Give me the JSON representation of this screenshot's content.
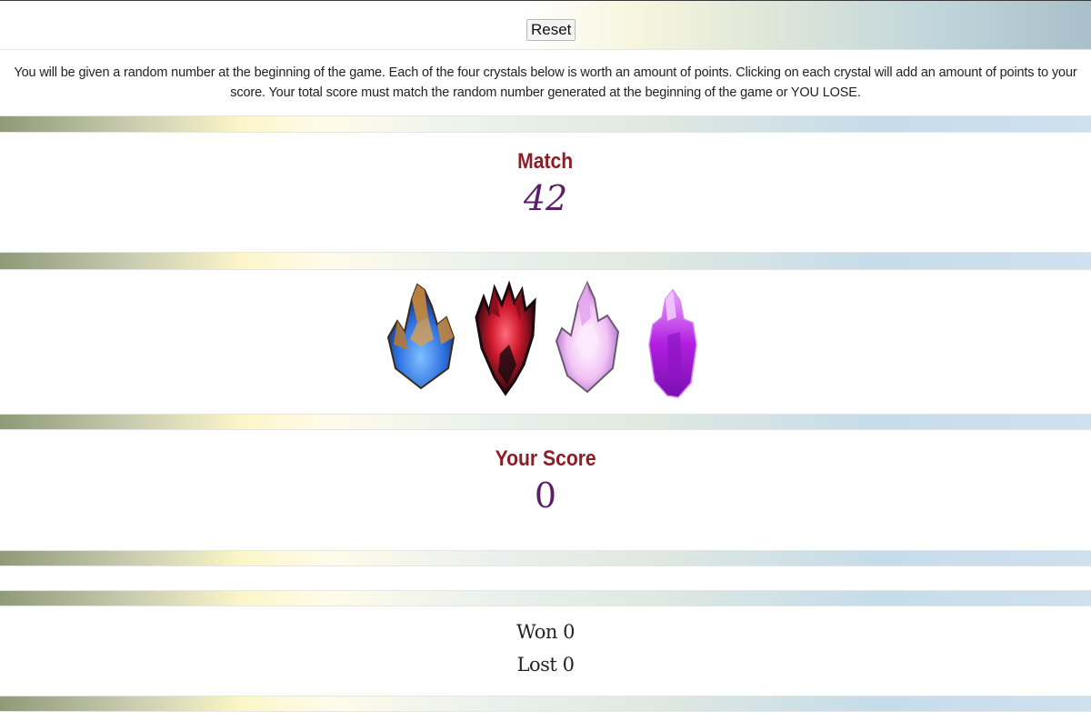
{
  "toolbar": {
    "reset_label": "Reset"
  },
  "instructions": {
    "text": "You will be given a random number at the beginning of the game. Each of the four crystals below is worth an amount of points. Clicking on each crystal will add an amount of points to your score. Your total score must match the random number generated at the beginning of the game or YOU LOSE."
  },
  "match": {
    "label": "Match",
    "value": "42"
  },
  "crystals": [
    {
      "name": "blue-amber-crystal",
      "colors": [
        "#c98a3a",
        "#2d6fe0"
      ]
    },
    {
      "name": "red-black-crystal",
      "colors": [
        "#d01a2e",
        "#1b0b10"
      ]
    },
    {
      "name": "pink-white-crystal",
      "colors": [
        "#f2c2f5",
        "#b66ad8"
      ]
    },
    {
      "name": "purple-crystal",
      "colors": [
        "#b21ee0",
        "#7a0fb0"
      ]
    }
  ],
  "score": {
    "label": "Your Score",
    "value": "0"
  },
  "record": {
    "won_label": "Won",
    "won_value": "0",
    "lost_label": "Lost",
    "lost_value": "0"
  },
  "colors": {
    "label_red": "#8b1e26",
    "number_purple": "#5b1f6a"
  }
}
